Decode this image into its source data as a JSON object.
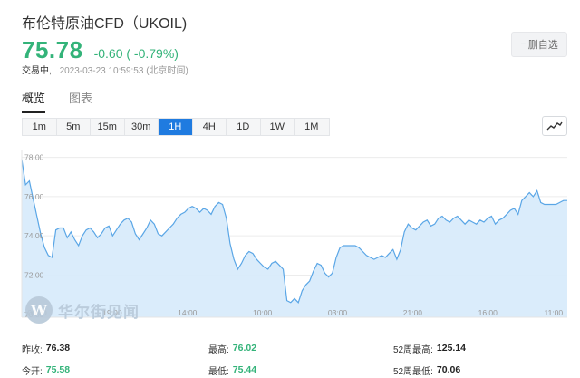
{
  "header": {
    "title": "布伦特原油CFD（UKOIL)",
    "price": "75.78",
    "change": "-0.60 ( -0.79%)",
    "status": "交易中,",
    "timestamp": "2023-03-23 10:59:53 (北京时间)",
    "remove_label": "删自选",
    "remove_icon": "minus-icon"
  },
  "tabs": [
    {
      "label": "概览",
      "active": true
    },
    {
      "label": "图表",
      "active": false
    }
  ],
  "periods": [
    {
      "label": "1m",
      "active": false
    },
    {
      "label": "5m",
      "active": false
    },
    {
      "label": "15m",
      "active": false
    },
    {
      "label": "30m",
      "active": false
    },
    {
      "label": "1H",
      "active": true
    },
    {
      "label": "4H",
      "active": false
    },
    {
      "label": "1D",
      "active": false
    },
    {
      "label": "1W",
      "active": false
    },
    {
      "label": "1M",
      "active": false
    }
  ],
  "chart_type_icon": "line-chart-icon",
  "watermark": {
    "logo_letter": "W",
    "text": "华尔街见闻"
  },
  "chart_data": {
    "type": "area",
    "y_ticks": [
      "78.00",
      "76.00",
      "74.00",
      "72.00",
      "70.00"
    ],
    "ylim": [
      69.85,
      78.35
    ],
    "x_ticks": [
      {
        "label": "00:00",
        "x": 7
      },
      {
        "label": "19:00",
        "x": 41
      },
      {
        "label": "14:00",
        "x": 75
      },
      {
        "label": "10:00",
        "x": 109
      },
      {
        "label": "03:00",
        "x": 143
      },
      {
        "label": "21:00",
        "x": 177
      },
      {
        "label": "16:00",
        "x": 211
      },
      {
        "label": "11:00",
        "x": 245
      }
    ],
    "x_range": [
      0,
      247
    ],
    "values": [
      77.9,
      76.6,
      76.8,
      75.9,
      75.0,
      74.1,
      73.4,
      73.0,
      72.9,
      74.3,
      74.4,
      74.4,
      73.9,
      74.2,
      73.8,
      73.5,
      74.0,
      74.3,
      74.4,
      74.2,
      73.9,
      74.1,
      74.4,
      74.5,
      74.0,
      74.3,
      74.6,
      74.8,
      74.9,
      74.7,
      74.1,
      73.8,
      74.1,
      74.4,
      74.8,
      74.6,
      74.1,
      74.0,
      74.2,
      74.4,
      74.6,
      74.9,
      75.1,
      75.2,
      75.4,
      75.5,
      75.4,
      75.2,
      75.4,
      75.3,
      75.1,
      75.5,
      75.7,
      75.6,
      74.9,
      73.6,
      72.8,
      72.3,
      72.6,
      73.0,
      73.2,
      73.1,
      72.8,
      72.6,
      72.4,
      72.3,
      72.6,
      72.7,
      72.5,
      72.3,
      70.7,
      70.6,
      70.8,
      70.6,
      71.2,
      71.5,
      71.7,
      72.2,
      72.6,
      72.5,
      72.1,
      71.9,
      72.1,
      72.9,
      73.4,
      73.5,
      73.5,
      73.5,
      73.5,
      73.4,
      73.2,
      73.0,
      72.9,
      72.8,
      72.9,
      73.0,
      72.9,
      73.1,
      73.3,
      72.8,
      73.3,
      74.2,
      74.6,
      74.4,
      74.3,
      74.5,
      74.7,
      74.8,
      74.5,
      74.6,
      74.9,
      75.0,
      74.8,
      74.7,
      74.9,
      75.0,
      74.8,
      74.6,
      74.8,
      74.7,
      74.6,
      74.8,
      74.7,
      74.9,
      75.0,
      74.6,
      74.8,
      74.9,
      75.1,
      75.3,
      75.4,
      75.1,
      75.8,
      76.0,
      76.2,
      76.0,
      76.3,
      75.7,
      75.6,
      75.6,
      75.6,
      75.6,
      75.7,
      75.8,
      75.8
    ]
  },
  "stats": [
    [
      {
        "label": "昨收:",
        "value": "76.38",
        "color": "#222222"
      },
      {
        "label": "最高:",
        "value": "76.02",
        "color": "#33b379"
      },
      {
        "label": "52周最高:",
        "value": "125.14",
        "color": "#222222"
      }
    ],
    [
      {
        "label": "今开:",
        "value": "75.58",
        "color": "#33b379"
      },
      {
        "label": "最低:",
        "value": "75.44",
        "color": "#33b379"
      },
      {
        "label": "52周最低:",
        "value": "70.06",
        "color": "#222222"
      }
    ]
  ],
  "colors": {
    "up": "#33b379",
    "accent": "#1f7be0",
    "line": "#5aa6e6",
    "fill": "#d8ebfb"
  }
}
